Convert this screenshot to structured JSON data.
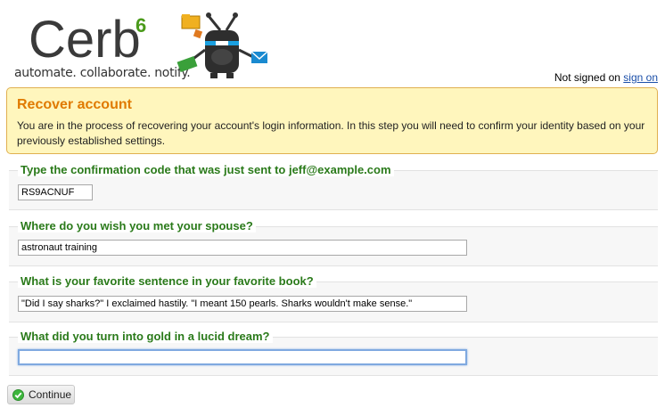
{
  "brand": {
    "name": "Cerb",
    "version": "6",
    "tagline": "automate. collaborate. notify."
  },
  "auth": {
    "status_text": "Not signed on",
    "link_label": "sign on"
  },
  "banner": {
    "title": "Recover account",
    "message": "You are in the process of recovering your account's login information. In this step you will need to confirm your identity based on your previously established settings."
  },
  "sections": [
    {
      "legend": "Type the confirmation code that was just sent to jeff@example.com",
      "value": "RS9ACNUF"
    },
    {
      "legend": "Where do you wish you met your spouse?",
      "value": "astronaut training"
    },
    {
      "legend": "What is your favorite sentence in your favorite book?",
      "value": "\"Did I say sharks?\" I exclaimed hastily. \"I meant 150 pearls. Sharks wouldn't make sense.\""
    },
    {
      "legend": "What did you turn into gold in a lucid dream?",
      "value": ""
    }
  ],
  "actions": {
    "continue_label": "Continue",
    "continue_icon": "check-circle-icon"
  },
  "colors": {
    "banner_bg": "#fff6bd",
    "banner_title": "#e07a00",
    "legend_green": "#2a7a1a",
    "link_blue": "#1a4ea8"
  }
}
